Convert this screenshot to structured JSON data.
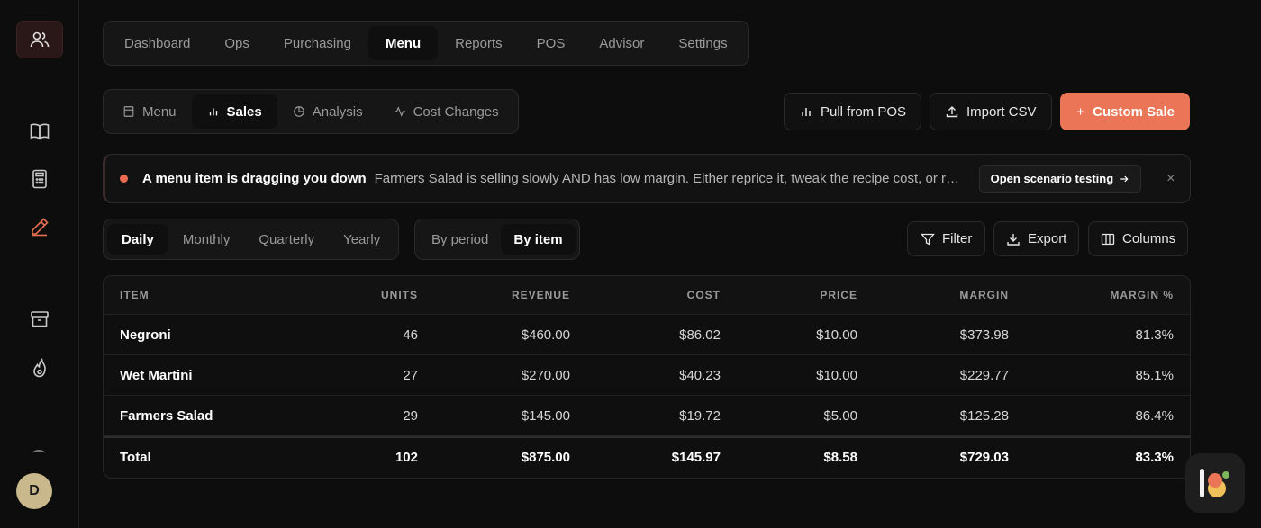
{
  "nav": {
    "tabs": [
      {
        "label": "Dashboard"
      },
      {
        "label": "Ops"
      },
      {
        "label": "Purchasing"
      },
      {
        "label": "Menu",
        "active": true
      },
      {
        "label": "Reports"
      },
      {
        "label": "POS"
      },
      {
        "label": "Advisor"
      },
      {
        "label": "Settings"
      }
    ]
  },
  "subnav": {
    "tabs": [
      {
        "label": "Menu",
        "icon": "document-icon"
      },
      {
        "label": "Sales",
        "icon": "bar-chart-icon",
        "active": true
      },
      {
        "label": "Analysis",
        "icon": "pie-chart-icon"
      },
      {
        "label": "Cost Changes",
        "icon": "activity-icon"
      }
    ]
  },
  "actions": {
    "pull": "Pull from POS",
    "import": "Import CSV",
    "custom": "Custom Sale"
  },
  "banner": {
    "title": "A menu item is dragging you down",
    "message": "Farmers Salad is selling slowly AND has low margin. Either reprice it, tweak the recipe cost, or remove it from the menu.",
    "button": "Open scenario testing",
    "close": "×"
  },
  "period": {
    "options": [
      {
        "label": "Daily",
        "active": true
      },
      {
        "label": "Monthly"
      },
      {
        "label": "Quarterly"
      },
      {
        "label": "Yearly"
      }
    ]
  },
  "mode": {
    "options": [
      {
        "label": "By period"
      },
      {
        "label": "By item",
        "active": true
      }
    ]
  },
  "tools": {
    "filter": "Filter",
    "export": "Export",
    "columns": "Columns"
  },
  "table": {
    "headers": [
      "ITEM",
      "UNITS",
      "REVENUE",
      "COST",
      "PRICE",
      "MARGIN",
      "MARGIN %"
    ],
    "rows": [
      [
        "Negroni",
        "46",
        "$460.00",
        "$86.02",
        "$10.00",
        "$373.98",
        "81.3%"
      ],
      [
        "Wet Martini",
        "27",
        "$270.00",
        "$40.23",
        "$10.00",
        "$229.77",
        "85.1%"
      ],
      [
        "Farmers Salad",
        "29",
        "$145.00",
        "$19.72",
        "$5.00",
        "$125.28",
        "86.4%"
      ]
    ],
    "total": [
      "Total",
      "102",
      "$875.00",
      "$145.97",
      "$8.58",
      "$729.03",
      "83.3%"
    ]
  },
  "user": {
    "initial": "D"
  },
  "colors": {
    "accent": "#ea7657",
    "background": "#0d0d0d"
  }
}
